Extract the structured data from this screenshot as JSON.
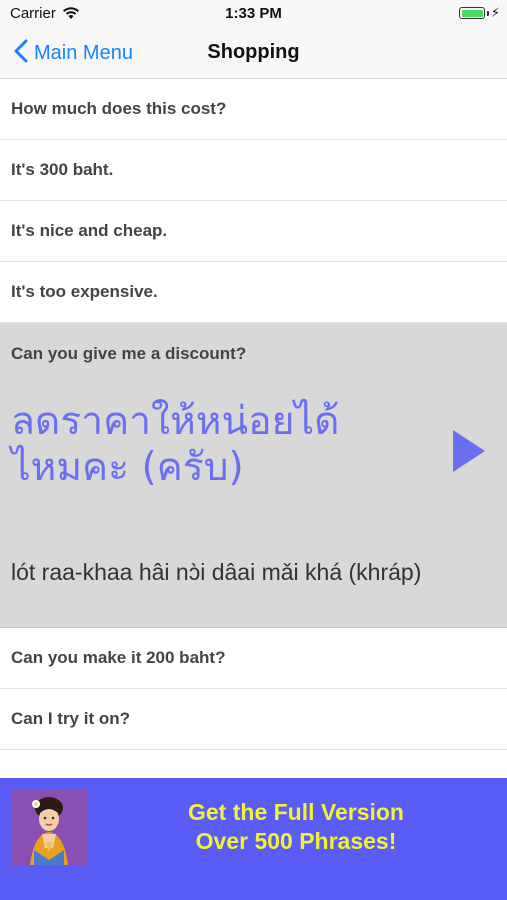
{
  "status_bar": {
    "carrier": "Carrier",
    "time": "1:33 PM",
    "battery_level": 1.0,
    "icons": [
      "wifi-icon",
      "battery-icon",
      "charging-bolt-icon"
    ]
  },
  "nav": {
    "back_label": "Main Menu",
    "title": "Shopping",
    "accent_color": "#1a82fb"
  },
  "phrases_top": [
    "How much does this cost?",
    "It's 300 baht.",
    "It's nice and cheap.",
    "It's too expensive."
  ],
  "expanded": {
    "question": "Can you give me a discount?",
    "thai_line1": "ลดราคาให้หน่อยได้",
    "thai_line2": "ไหมคะ (ครับ)",
    "romanization": "lót raa-khaa hâi nɔ̀i dâai mǎi khá (khráp)",
    "thai_color": "#6a6ff0"
  },
  "phrases_bottom": [
    "Can you make it 200 baht?",
    "Can I try it on?"
  ],
  "banner": {
    "line1": "Get the Full Version",
    "line2": "Over 500 Phrases!",
    "background": "#5a5cf6",
    "text_color": "#f2f237"
  }
}
